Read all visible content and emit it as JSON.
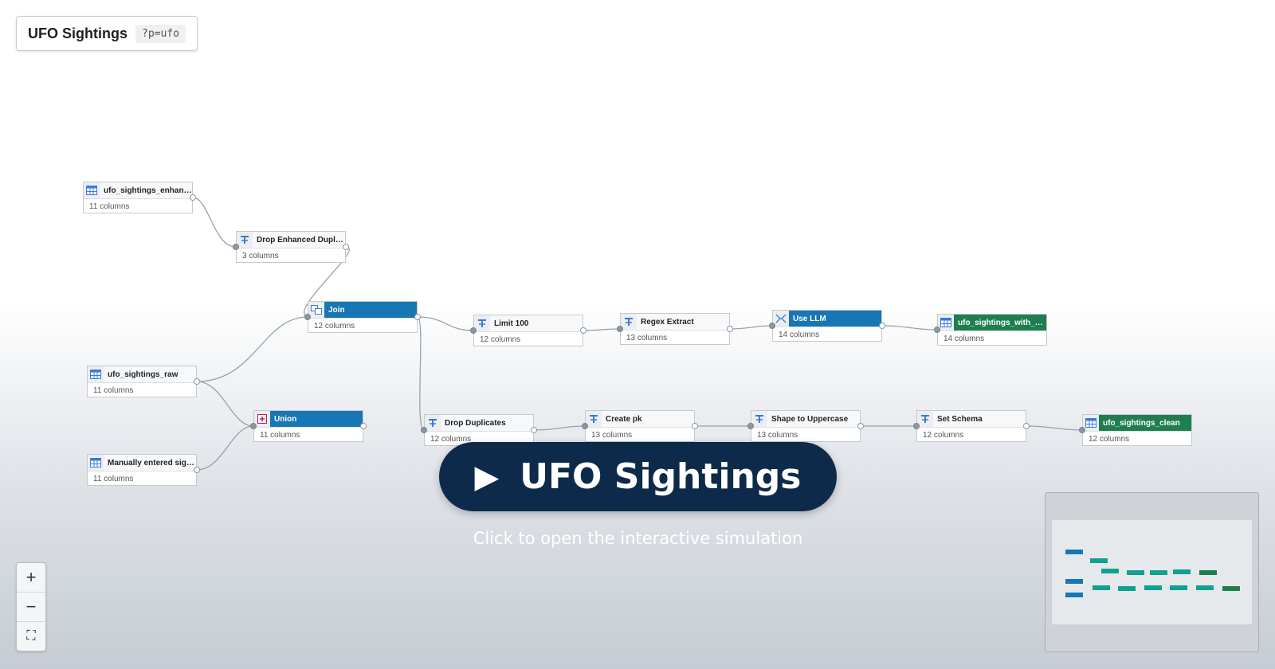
{
  "header": {
    "title": "UFO Sightings",
    "query": "?p=ufo"
  },
  "nodes": [
    {
      "id": "n1",
      "name": "ufo_sightings_enhan…",
      "cols": "11 columns",
      "icon": "table-icon"
    },
    {
      "id": "n2",
      "name": "Drop Enhanced Dupli…",
      "cols": "3 columns",
      "icon": "transform-icon"
    },
    {
      "id": "n3",
      "name": "Join",
      "cols": "12 columns",
      "icon": "join-icon"
    },
    {
      "id": "n4",
      "name": "ufo_sightings_raw",
      "cols": "11 columns",
      "icon": "table-icon"
    },
    {
      "id": "n5",
      "name": "Union",
      "cols": "11 columns",
      "icon": "union-icon"
    },
    {
      "id": "n6",
      "name": "Manually entered sig…",
      "cols": "11 columns",
      "icon": "table-icon"
    },
    {
      "id": "n7",
      "name": "Limit 100",
      "cols": "12 columns",
      "icon": "transform-icon"
    },
    {
      "id": "n8",
      "name": "Regex Extract",
      "cols": "13 columns",
      "icon": "transform-icon"
    },
    {
      "id": "n9",
      "name": "Use LLM",
      "cols": "14 columns",
      "icon": "llm-icon"
    },
    {
      "id": "n10",
      "name": "ufo_sightings_with_c…",
      "cols": "14 columns",
      "icon": "table-icon"
    },
    {
      "id": "n11",
      "name": "Drop Duplicates",
      "cols": "12 columns",
      "icon": "transform-icon"
    },
    {
      "id": "n12",
      "name": "Create pk",
      "cols": "13 columns",
      "icon": "transform-icon"
    },
    {
      "id": "n13",
      "name": "Shape to Uppercase",
      "cols": "13 columns",
      "icon": "transform-icon"
    },
    {
      "id": "n14",
      "name": "Set Schema",
      "cols": "12 columns",
      "icon": "transform-icon"
    },
    {
      "id": "n15",
      "name": "ufo_sightings_clean",
      "cols": "12 columns",
      "icon": "table-icon"
    }
  ],
  "cta": {
    "play": "▶",
    "label": "UFO Sightings",
    "subtitle": "Click to open the interactive simulation"
  },
  "zoom": {
    "in": "+",
    "out": "−",
    "fit": "⛶"
  },
  "colors": {
    "accent_blue": "#1776b4",
    "output_green": "#1e7e4f",
    "cta_bg": "#0d2a4b",
    "transform_icon": "#3a7bd5",
    "union_icon": "#c2185b"
  }
}
